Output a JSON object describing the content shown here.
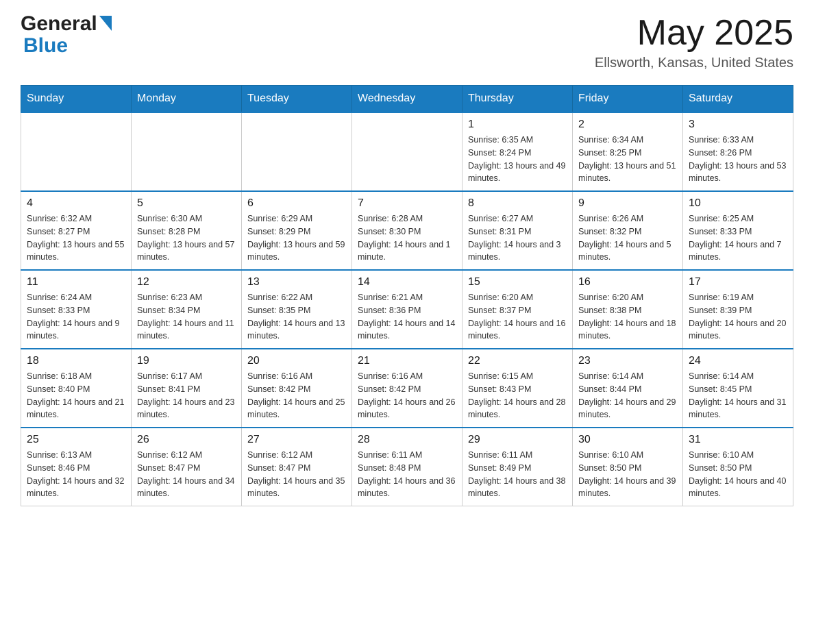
{
  "header": {
    "month_title": "May 2025",
    "location": "Ellsworth, Kansas, United States",
    "logo_line1": "General",
    "logo_line2": "Blue"
  },
  "days_of_week": [
    "Sunday",
    "Monday",
    "Tuesday",
    "Wednesday",
    "Thursday",
    "Friday",
    "Saturday"
  ],
  "weeks": [
    {
      "cells": [
        {
          "day": "",
          "info": ""
        },
        {
          "day": "",
          "info": ""
        },
        {
          "day": "",
          "info": ""
        },
        {
          "day": "",
          "info": ""
        },
        {
          "day": "1",
          "info": "Sunrise: 6:35 AM\nSunset: 8:24 PM\nDaylight: 13 hours and 49 minutes."
        },
        {
          "day": "2",
          "info": "Sunrise: 6:34 AM\nSunset: 8:25 PM\nDaylight: 13 hours and 51 minutes."
        },
        {
          "day": "3",
          "info": "Sunrise: 6:33 AM\nSunset: 8:26 PM\nDaylight: 13 hours and 53 minutes."
        }
      ]
    },
    {
      "cells": [
        {
          "day": "4",
          "info": "Sunrise: 6:32 AM\nSunset: 8:27 PM\nDaylight: 13 hours and 55 minutes."
        },
        {
          "day": "5",
          "info": "Sunrise: 6:30 AM\nSunset: 8:28 PM\nDaylight: 13 hours and 57 minutes."
        },
        {
          "day": "6",
          "info": "Sunrise: 6:29 AM\nSunset: 8:29 PM\nDaylight: 13 hours and 59 minutes."
        },
        {
          "day": "7",
          "info": "Sunrise: 6:28 AM\nSunset: 8:30 PM\nDaylight: 14 hours and 1 minute."
        },
        {
          "day": "8",
          "info": "Sunrise: 6:27 AM\nSunset: 8:31 PM\nDaylight: 14 hours and 3 minutes."
        },
        {
          "day": "9",
          "info": "Sunrise: 6:26 AM\nSunset: 8:32 PM\nDaylight: 14 hours and 5 minutes."
        },
        {
          "day": "10",
          "info": "Sunrise: 6:25 AM\nSunset: 8:33 PM\nDaylight: 14 hours and 7 minutes."
        }
      ]
    },
    {
      "cells": [
        {
          "day": "11",
          "info": "Sunrise: 6:24 AM\nSunset: 8:33 PM\nDaylight: 14 hours and 9 minutes."
        },
        {
          "day": "12",
          "info": "Sunrise: 6:23 AM\nSunset: 8:34 PM\nDaylight: 14 hours and 11 minutes."
        },
        {
          "day": "13",
          "info": "Sunrise: 6:22 AM\nSunset: 8:35 PM\nDaylight: 14 hours and 13 minutes."
        },
        {
          "day": "14",
          "info": "Sunrise: 6:21 AM\nSunset: 8:36 PM\nDaylight: 14 hours and 14 minutes."
        },
        {
          "day": "15",
          "info": "Sunrise: 6:20 AM\nSunset: 8:37 PM\nDaylight: 14 hours and 16 minutes."
        },
        {
          "day": "16",
          "info": "Sunrise: 6:20 AM\nSunset: 8:38 PM\nDaylight: 14 hours and 18 minutes."
        },
        {
          "day": "17",
          "info": "Sunrise: 6:19 AM\nSunset: 8:39 PM\nDaylight: 14 hours and 20 minutes."
        }
      ]
    },
    {
      "cells": [
        {
          "day": "18",
          "info": "Sunrise: 6:18 AM\nSunset: 8:40 PM\nDaylight: 14 hours and 21 minutes."
        },
        {
          "day": "19",
          "info": "Sunrise: 6:17 AM\nSunset: 8:41 PM\nDaylight: 14 hours and 23 minutes."
        },
        {
          "day": "20",
          "info": "Sunrise: 6:16 AM\nSunset: 8:42 PM\nDaylight: 14 hours and 25 minutes."
        },
        {
          "day": "21",
          "info": "Sunrise: 6:16 AM\nSunset: 8:42 PM\nDaylight: 14 hours and 26 minutes."
        },
        {
          "day": "22",
          "info": "Sunrise: 6:15 AM\nSunset: 8:43 PM\nDaylight: 14 hours and 28 minutes."
        },
        {
          "day": "23",
          "info": "Sunrise: 6:14 AM\nSunset: 8:44 PM\nDaylight: 14 hours and 29 minutes."
        },
        {
          "day": "24",
          "info": "Sunrise: 6:14 AM\nSunset: 8:45 PM\nDaylight: 14 hours and 31 minutes."
        }
      ]
    },
    {
      "cells": [
        {
          "day": "25",
          "info": "Sunrise: 6:13 AM\nSunset: 8:46 PM\nDaylight: 14 hours and 32 minutes."
        },
        {
          "day": "26",
          "info": "Sunrise: 6:12 AM\nSunset: 8:47 PM\nDaylight: 14 hours and 34 minutes."
        },
        {
          "day": "27",
          "info": "Sunrise: 6:12 AM\nSunset: 8:47 PM\nDaylight: 14 hours and 35 minutes."
        },
        {
          "day": "28",
          "info": "Sunrise: 6:11 AM\nSunset: 8:48 PM\nDaylight: 14 hours and 36 minutes."
        },
        {
          "day": "29",
          "info": "Sunrise: 6:11 AM\nSunset: 8:49 PM\nDaylight: 14 hours and 38 minutes."
        },
        {
          "day": "30",
          "info": "Sunrise: 6:10 AM\nSunset: 8:50 PM\nDaylight: 14 hours and 39 minutes."
        },
        {
          "day": "31",
          "info": "Sunrise: 6:10 AM\nSunset: 8:50 PM\nDaylight: 14 hours and 40 minutes."
        }
      ]
    }
  ]
}
